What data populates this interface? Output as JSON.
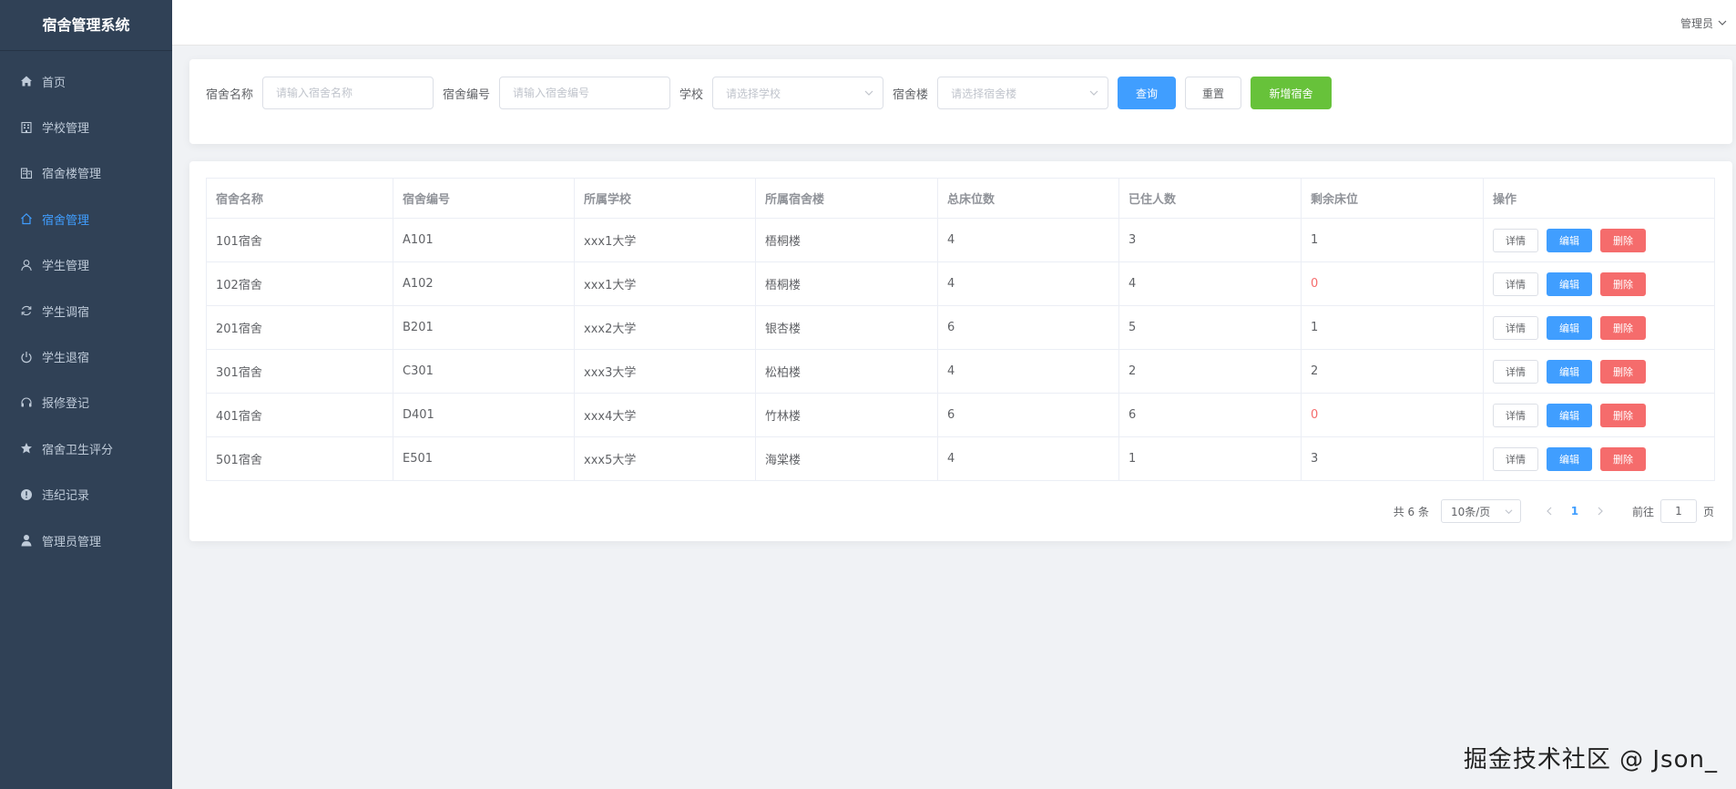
{
  "app": {
    "title": "宿舍管理系统"
  },
  "header": {
    "user": "管理员"
  },
  "sidebar": {
    "items": [
      {
        "label": "首页",
        "icon": "home-icon",
        "active": false
      },
      {
        "label": "学校管理",
        "icon": "building-icon",
        "active": false
      },
      {
        "label": "宿舍楼管理",
        "icon": "office-building-icon",
        "active": false
      },
      {
        "label": "宿舍管理",
        "icon": "house-icon",
        "active": true
      },
      {
        "label": "学生管理",
        "icon": "user-icon",
        "active": false
      },
      {
        "label": "学生调宿",
        "icon": "refresh-icon",
        "active": false
      },
      {
        "label": "学生退宿",
        "icon": "power-icon",
        "active": false
      },
      {
        "label": "报修登记",
        "icon": "headset-icon",
        "active": false
      },
      {
        "label": "宿舍卫生评分",
        "icon": "star-icon",
        "active": false
      },
      {
        "label": "违纪记录",
        "icon": "warning-icon",
        "active": false
      },
      {
        "label": "管理员管理",
        "icon": "person-icon",
        "active": false
      }
    ]
  },
  "search": {
    "name_label": "宿舍名称",
    "name_placeholder": "请输入宿舍名称",
    "code_label": "宿舍编号",
    "code_placeholder": "请输入宿舍编号",
    "school_label": "学校",
    "school_placeholder": "请选择学校",
    "building_label": "宿舍楼",
    "building_placeholder": "请选择宿舍楼",
    "query_label": "查询",
    "reset_label": "重置",
    "add_label": "新增宿舍"
  },
  "table": {
    "columns": [
      "宿舍名称",
      "宿舍编号",
      "所属学校",
      "所属宿舍楼",
      "总床位数",
      "已住人数",
      "剩余床位",
      "操作"
    ],
    "rows": [
      {
        "name": "101宿舍",
        "code": "A101",
        "school": "xxx1大学",
        "building": "梧桐楼",
        "total": "4",
        "occupied": "3",
        "remaining": "1"
      },
      {
        "name": "102宿舍",
        "code": "A102",
        "school": "xxx1大学",
        "building": "梧桐楼",
        "total": "4",
        "occupied": "4",
        "remaining": "0"
      },
      {
        "name": "201宿舍",
        "code": "B201",
        "school": "xxx2大学",
        "building": "银杏楼",
        "total": "6",
        "occupied": "5",
        "remaining": "1"
      },
      {
        "name": "301宿舍",
        "code": "C301",
        "school": "xxx3大学",
        "building": "松柏楼",
        "total": "4",
        "occupied": "2",
        "remaining": "2"
      },
      {
        "name": "401宿舍",
        "code": "D401",
        "school": "xxx4大学",
        "building": "竹林楼",
        "total": "6",
        "occupied": "6",
        "remaining": "0"
      },
      {
        "name": "501宿舍",
        "code": "E501",
        "school": "xxx5大学",
        "building": "海棠楼",
        "total": "4",
        "occupied": "1",
        "remaining": "3"
      }
    ],
    "actions": {
      "detail": "详情",
      "edit": "编辑",
      "delete": "删除"
    }
  },
  "pagination": {
    "total_text": "共 6 条",
    "page_size": "10条/页",
    "current_page": "1",
    "goto_label": "前往",
    "goto_value": "1",
    "page_unit": "页"
  },
  "watermark": "掘金技术社区 @ Json_",
  "colors": {
    "sidebar_bg": "#304156",
    "sidebar_text": "#bfcbd9",
    "active": "#409eff",
    "success": "#67c23a",
    "danger": "#f56c6c"
  }
}
